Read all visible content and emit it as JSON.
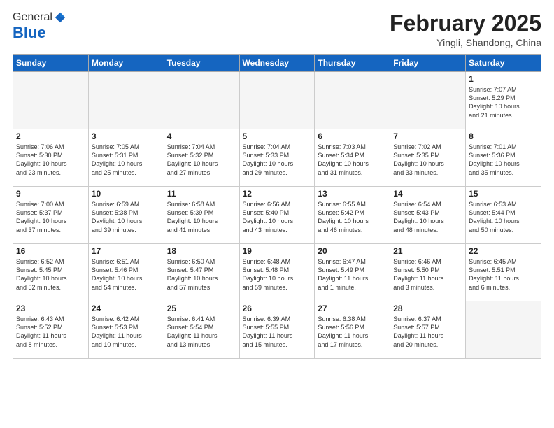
{
  "header": {
    "logo_general": "General",
    "logo_blue": "Blue",
    "month_title": "February 2025",
    "subtitle": "Yingli, Shandong, China"
  },
  "weekdays": [
    "Sunday",
    "Monday",
    "Tuesday",
    "Wednesday",
    "Thursday",
    "Friday",
    "Saturday"
  ],
  "weeks": [
    [
      {
        "day": "",
        "info": ""
      },
      {
        "day": "",
        "info": ""
      },
      {
        "day": "",
        "info": ""
      },
      {
        "day": "",
        "info": ""
      },
      {
        "day": "",
        "info": ""
      },
      {
        "day": "",
        "info": ""
      },
      {
        "day": "1",
        "info": "Sunrise: 7:07 AM\nSunset: 5:29 PM\nDaylight: 10 hours\nand 21 minutes."
      }
    ],
    [
      {
        "day": "2",
        "info": "Sunrise: 7:06 AM\nSunset: 5:30 PM\nDaylight: 10 hours\nand 23 minutes."
      },
      {
        "day": "3",
        "info": "Sunrise: 7:05 AM\nSunset: 5:31 PM\nDaylight: 10 hours\nand 25 minutes."
      },
      {
        "day": "4",
        "info": "Sunrise: 7:04 AM\nSunset: 5:32 PM\nDaylight: 10 hours\nand 27 minutes."
      },
      {
        "day": "5",
        "info": "Sunrise: 7:04 AM\nSunset: 5:33 PM\nDaylight: 10 hours\nand 29 minutes."
      },
      {
        "day": "6",
        "info": "Sunrise: 7:03 AM\nSunset: 5:34 PM\nDaylight: 10 hours\nand 31 minutes."
      },
      {
        "day": "7",
        "info": "Sunrise: 7:02 AM\nSunset: 5:35 PM\nDaylight: 10 hours\nand 33 minutes."
      },
      {
        "day": "8",
        "info": "Sunrise: 7:01 AM\nSunset: 5:36 PM\nDaylight: 10 hours\nand 35 minutes."
      }
    ],
    [
      {
        "day": "9",
        "info": "Sunrise: 7:00 AM\nSunset: 5:37 PM\nDaylight: 10 hours\nand 37 minutes."
      },
      {
        "day": "10",
        "info": "Sunrise: 6:59 AM\nSunset: 5:38 PM\nDaylight: 10 hours\nand 39 minutes."
      },
      {
        "day": "11",
        "info": "Sunrise: 6:58 AM\nSunset: 5:39 PM\nDaylight: 10 hours\nand 41 minutes."
      },
      {
        "day": "12",
        "info": "Sunrise: 6:56 AM\nSunset: 5:40 PM\nDaylight: 10 hours\nand 43 minutes."
      },
      {
        "day": "13",
        "info": "Sunrise: 6:55 AM\nSunset: 5:42 PM\nDaylight: 10 hours\nand 46 minutes."
      },
      {
        "day": "14",
        "info": "Sunrise: 6:54 AM\nSunset: 5:43 PM\nDaylight: 10 hours\nand 48 minutes."
      },
      {
        "day": "15",
        "info": "Sunrise: 6:53 AM\nSunset: 5:44 PM\nDaylight: 10 hours\nand 50 minutes."
      }
    ],
    [
      {
        "day": "16",
        "info": "Sunrise: 6:52 AM\nSunset: 5:45 PM\nDaylight: 10 hours\nand 52 minutes."
      },
      {
        "day": "17",
        "info": "Sunrise: 6:51 AM\nSunset: 5:46 PM\nDaylight: 10 hours\nand 54 minutes."
      },
      {
        "day": "18",
        "info": "Sunrise: 6:50 AM\nSunset: 5:47 PM\nDaylight: 10 hours\nand 57 minutes."
      },
      {
        "day": "19",
        "info": "Sunrise: 6:48 AM\nSunset: 5:48 PM\nDaylight: 10 hours\nand 59 minutes."
      },
      {
        "day": "20",
        "info": "Sunrise: 6:47 AM\nSunset: 5:49 PM\nDaylight: 11 hours\nand 1 minute."
      },
      {
        "day": "21",
        "info": "Sunrise: 6:46 AM\nSunset: 5:50 PM\nDaylight: 11 hours\nand 3 minutes."
      },
      {
        "day": "22",
        "info": "Sunrise: 6:45 AM\nSunset: 5:51 PM\nDaylight: 11 hours\nand 6 minutes."
      }
    ],
    [
      {
        "day": "23",
        "info": "Sunrise: 6:43 AM\nSunset: 5:52 PM\nDaylight: 11 hours\nand 8 minutes."
      },
      {
        "day": "24",
        "info": "Sunrise: 6:42 AM\nSunset: 5:53 PM\nDaylight: 11 hours\nand 10 minutes."
      },
      {
        "day": "25",
        "info": "Sunrise: 6:41 AM\nSunset: 5:54 PM\nDaylight: 11 hours\nand 13 minutes."
      },
      {
        "day": "26",
        "info": "Sunrise: 6:39 AM\nSunset: 5:55 PM\nDaylight: 11 hours\nand 15 minutes."
      },
      {
        "day": "27",
        "info": "Sunrise: 6:38 AM\nSunset: 5:56 PM\nDaylight: 11 hours\nand 17 minutes."
      },
      {
        "day": "28",
        "info": "Sunrise: 6:37 AM\nSunset: 5:57 PM\nDaylight: 11 hours\nand 20 minutes."
      },
      {
        "day": "",
        "info": ""
      }
    ]
  ]
}
